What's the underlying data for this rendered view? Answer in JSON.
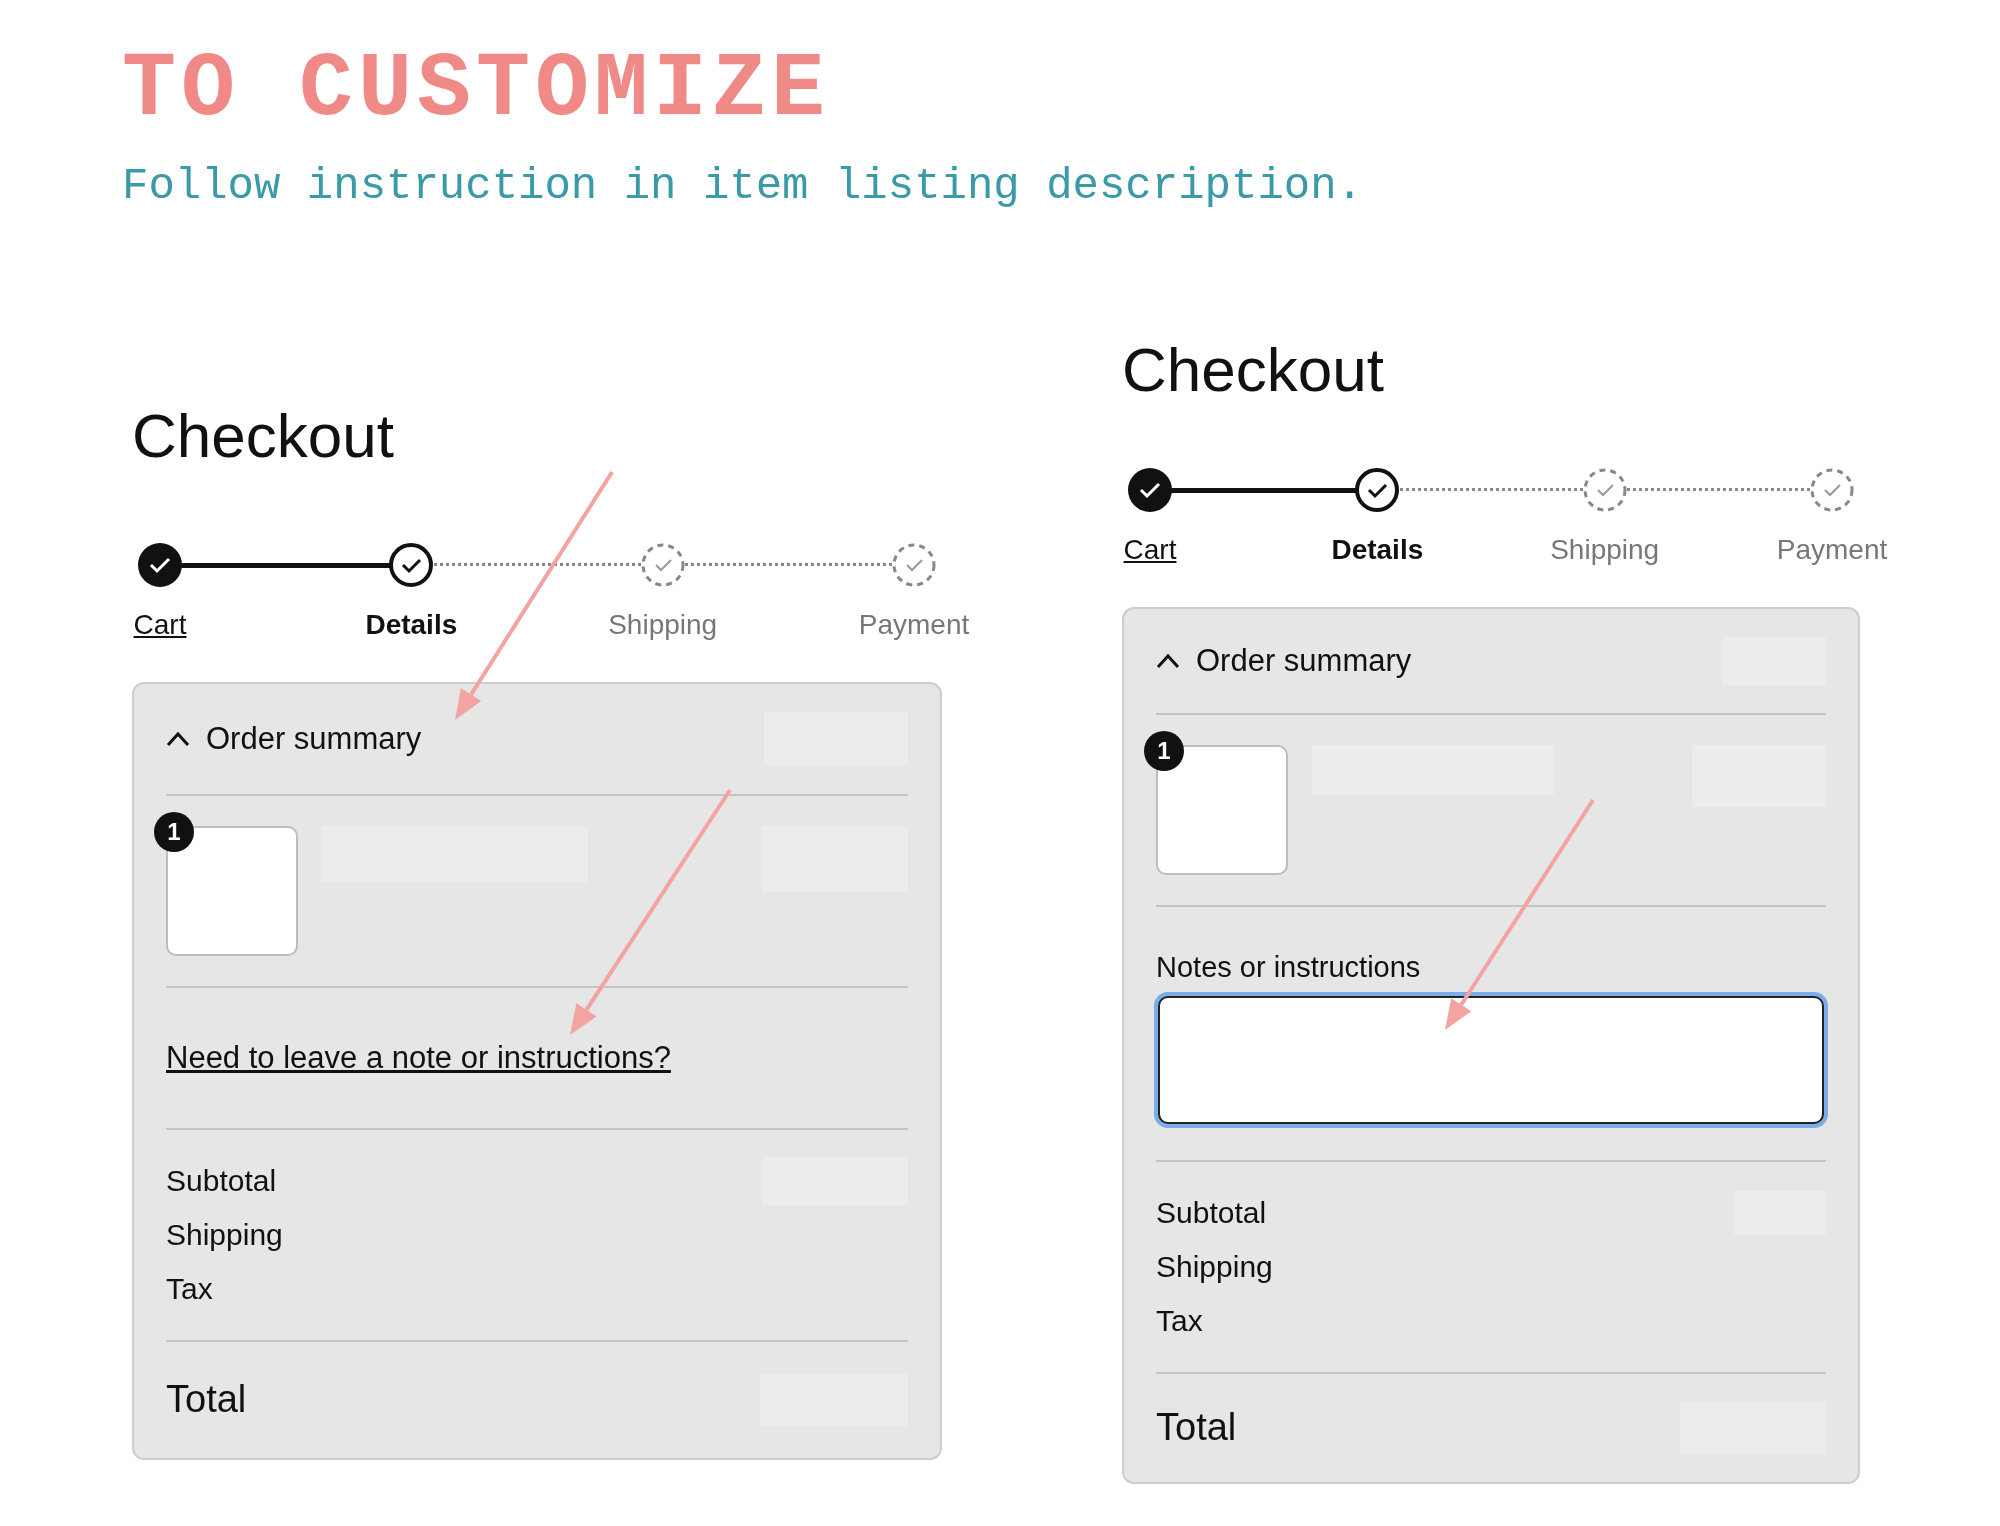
{
  "header": {
    "title": "TO CUSTOMIZE",
    "subtitle": "Follow instruction in item listing description."
  },
  "panels": [
    {
      "title": "Checkout",
      "steps": [
        {
          "label": "Cart",
          "completed": true,
          "selected": false
        },
        {
          "label": "Details",
          "completed": false,
          "selected": true
        },
        {
          "label": "Shipping",
          "completed": false,
          "selected": false
        },
        {
          "label": "Payment",
          "completed": false,
          "selected": false
        }
      ],
      "summary": {
        "label": "Order summary",
        "expanded": true
      },
      "item": {
        "quantity": "1"
      },
      "note": {
        "kind": "link",
        "text": "Need to leave a note or instructions?"
      },
      "totals": [
        "Subtotal",
        "Shipping",
        "Tax"
      ],
      "total_label": "Total"
    },
    {
      "title": "Checkout",
      "steps": [
        {
          "label": "Cart",
          "completed": true,
          "selected": false
        },
        {
          "label": "Details",
          "completed": false,
          "selected": true
        },
        {
          "label": "Shipping",
          "completed": false,
          "selected": false
        },
        {
          "label": "Payment",
          "completed": false,
          "selected": false
        }
      ],
      "summary": {
        "label": "Order summary",
        "expanded": true
      },
      "item": {
        "quantity": "1"
      },
      "note": {
        "kind": "field",
        "text": "Notes or instructions",
        "focused": true
      },
      "totals": [
        "Subtotal",
        "Shipping",
        "Tax"
      ],
      "total_label": "Total"
    }
  ]
}
